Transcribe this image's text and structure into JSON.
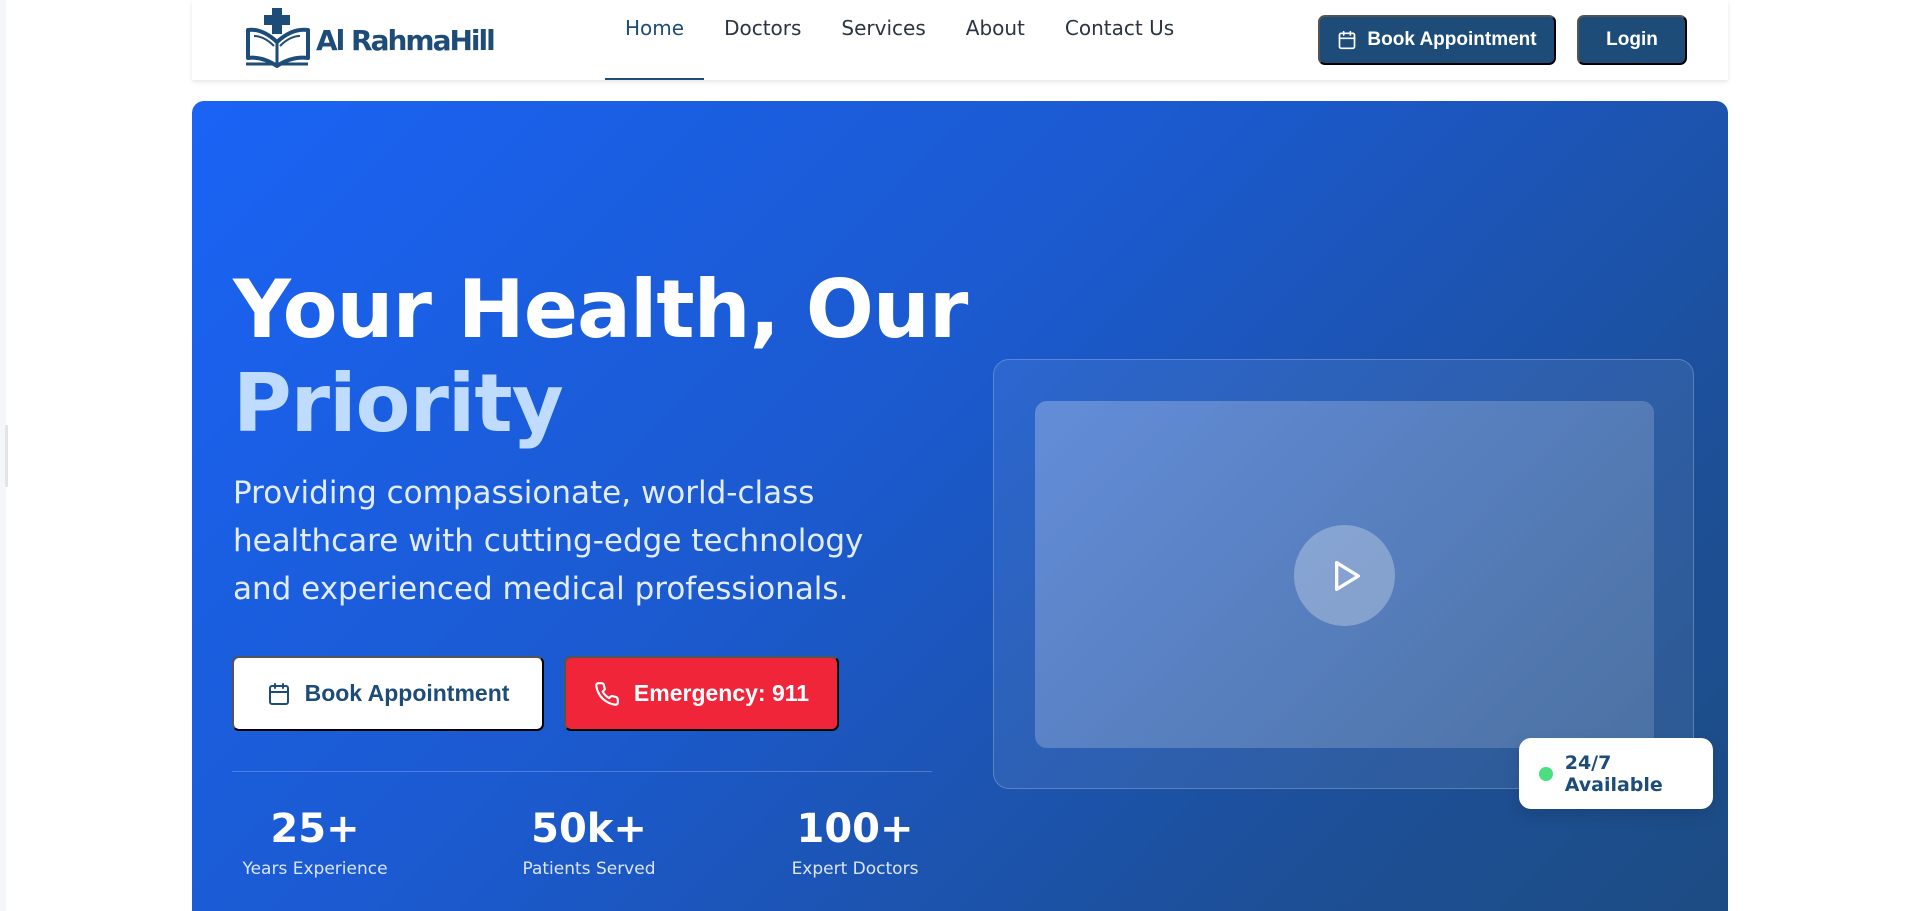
{
  "brand": {
    "name": "Al RahmaHill",
    "color": "#1d4c78"
  },
  "nav": {
    "links": [
      {
        "label": "Home",
        "active": true
      },
      {
        "label": "Doctors"
      },
      {
        "label": "Services"
      },
      {
        "label": "About"
      },
      {
        "label": "Contact Us"
      }
    ],
    "book_label": "Book Appointment",
    "login_label": "Login"
  },
  "hero": {
    "title_line1": "Your Health, Our",
    "title_line2": "Priority",
    "subtitle": "Providing compassionate, world-class healthcare with cutting-edge technology and experienced medical professionals.",
    "cta_book": "Book Appointment",
    "cta_emergency": "Emergency: 911",
    "stats": [
      {
        "value": "25+",
        "label": "Years Experience"
      },
      {
        "value": "50k+",
        "label": "Patients Served"
      },
      {
        "value": "100+",
        "label": "Expert Doctors"
      }
    ],
    "badge": "24/7 Available"
  },
  "colors": {
    "primary": "#1d4c78",
    "hero_gradient_start": "#1a63f5",
    "hero_gradient_end": "#1d4c82",
    "emergency": "#f0253a",
    "accent_text": "#bfdbfe",
    "status_dot": "#4ade80"
  },
  "icons": {
    "calendar": "calendar-icon",
    "phone": "phone-icon",
    "play": "play-icon",
    "logo": "book-cross-logo"
  }
}
